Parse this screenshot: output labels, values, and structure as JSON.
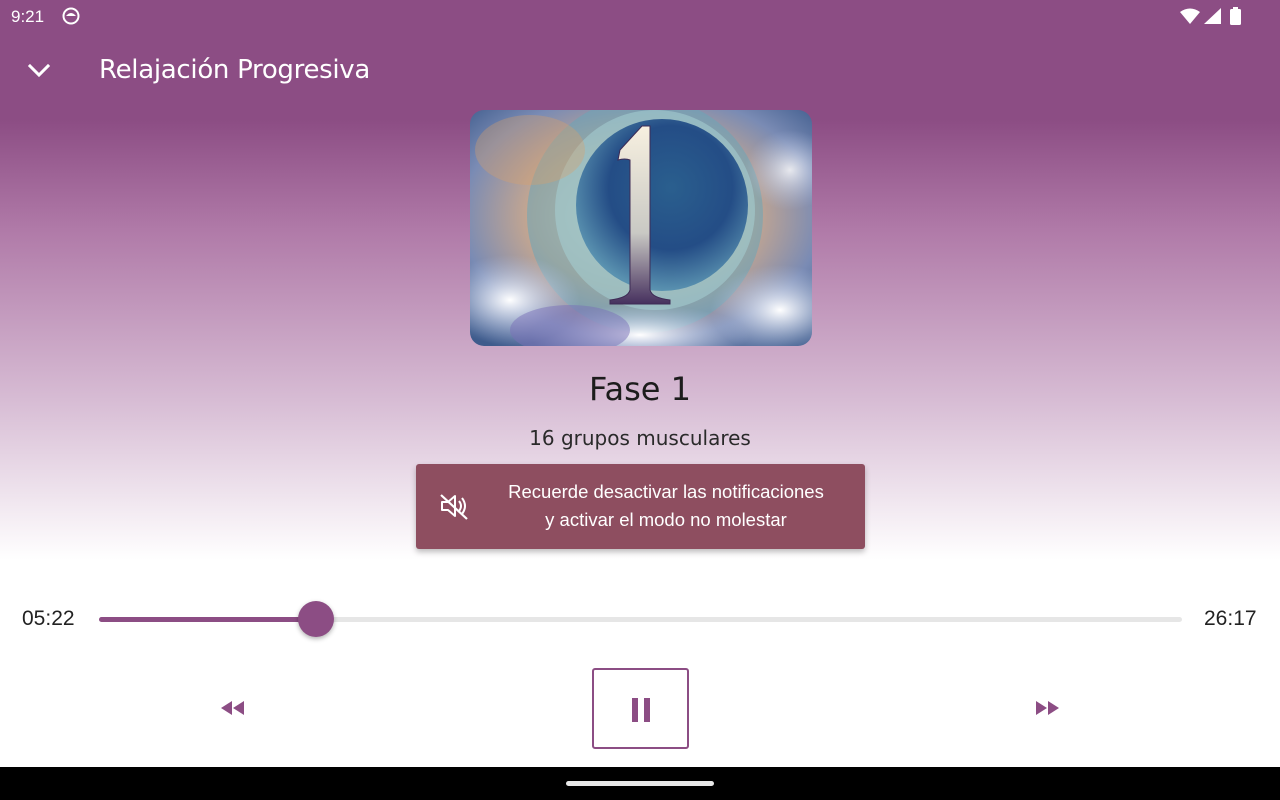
{
  "status_bar": {
    "time": "9:21",
    "app_icon": "notification-app-icon",
    "wifi_icon": "wifi-icon",
    "signal_icon": "cell-signal-icon",
    "battery_icon": "battery-icon"
  },
  "app_bar": {
    "back_icon": "chevron-down-icon",
    "title": "Relajación Progresiva"
  },
  "artwork": {
    "description_icon": "cover-art-image",
    "numeral": "1"
  },
  "track": {
    "title": "Fase 1",
    "subtitle": "16 grupos musculares"
  },
  "notice": {
    "icon": "volume-off-icon",
    "line1": "Recuerde desactivar las notificaciones",
    "line2": "y activar el modo no molestar"
  },
  "player": {
    "elapsed": "05:22",
    "total": "26:17",
    "progress_fraction": 0.2,
    "rewind_icon": "rewind-icon",
    "pause_icon": "pause-icon",
    "forward_icon": "fast-forward-icon"
  },
  "colors": {
    "accent": "#8c4d84",
    "notice_bg": "#8e4e60",
    "track_bg": "#e6e6e6"
  }
}
